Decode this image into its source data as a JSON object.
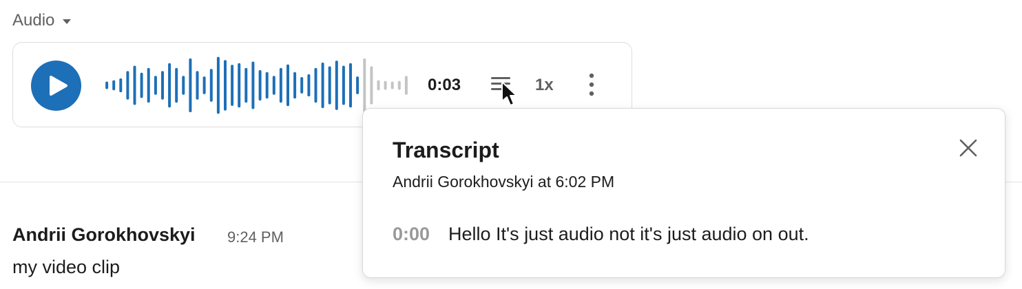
{
  "audio_header": {
    "label": "Audio",
    "caret_icon": "caret-down-icon"
  },
  "player": {
    "play_icon": "play-icon",
    "time": "0:03",
    "transcript_icon": "transcript-icon",
    "speed": "1x",
    "more_icon": "more-vertical-icon",
    "waveform_bars": [
      0.12,
      0.16,
      0.22,
      0.45,
      0.62,
      0.4,
      0.55,
      0.3,
      0.45,
      0.7,
      0.55,
      0.3,
      0.85,
      0.45,
      0.28,
      0.52,
      0.9,
      0.8,
      0.65,
      0.7,
      0.55,
      0.75,
      0.48,
      0.42,
      0.3,
      0.55,
      0.66,
      0.42,
      0.26,
      0.35,
      0.55,
      0.72,
      0.6,
      0.78,
      0.62,
      0.7,
      0.28,
      0.85,
      0.6,
      0.16,
      0.14,
      0.12,
      0.14,
      0.3
    ],
    "played_fraction": 0.84,
    "colors": {
      "accent": "#1d6fb8",
      "unplayed": "#c4c4c4"
    }
  },
  "message": {
    "author": "Andrii Gorokhovskyi",
    "time": "9:24 PM",
    "text": "my video clip"
  },
  "transcript": {
    "title": "Transcript",
    "subtitle": "Andrii Gorokhovskyi at 6:02 PM",
    "close_icon": "close-icon",
    "lines": [
      {
        "time": "0:00",
        "text": "Hello It's just audio not it's just audio on out."
      }
    ]
  },
  "cursor_icon": "mouse-pointer-icon"
}
